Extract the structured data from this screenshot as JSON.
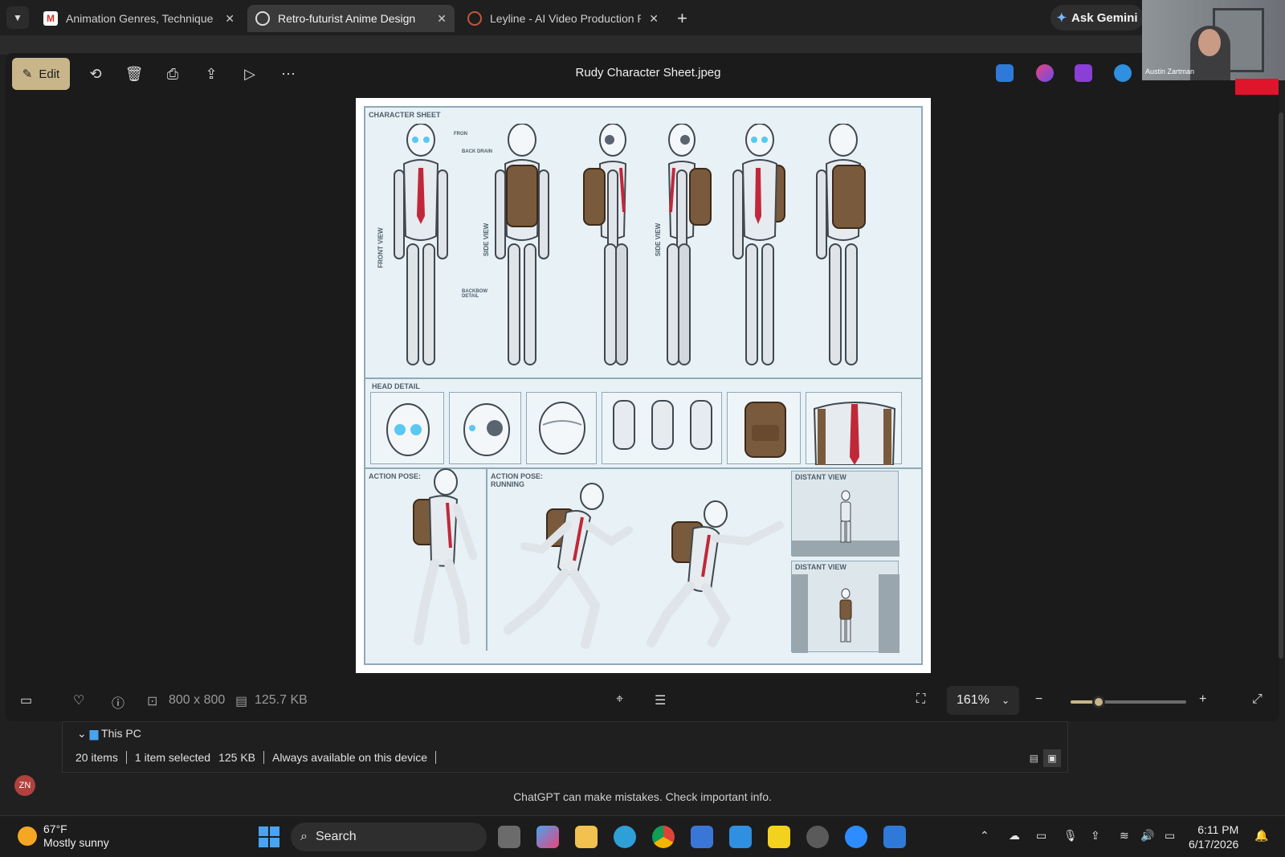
{
  "browser": {
    "tabs": [
      {
        "title": "Animation Genres, Technique a",
        "favicon": "gmail-icon"
      },
      {
        "title": "Retro-futurist Anime Design",
        "favicon": "chatgpt-icon"
      },
      {
        "title": "Leyline - AI Video Production P",
        "favicon": "leyline-icon"
      }
    ],
    "ask_gemini": "Ask Gemini"
  },
  "viewer": {
    "edit_label": "Edit",
    "file_title": "Rudy Character Sheet.jpeg",
    "dimensions": "800 x 800",
    "file_size": "125.7 KB",
    "zoom": "161%",
    "zoom_fraction": 0.24
  },
  "sheet": {
    "title": "CHARACTER SHEET",
    "front_view": "FRONT VIEW",
    "side_view_1": "SIDE VIEW",
    "side_view_2": "SIDE VIEW",
    "fron": "FRON",
    "back_drain": "BACK DRAIN",
    "backbow_detail": "BACKBOW DETAIL",
    "head_detail": "HEAD DETAIL",
    "action_pose": "ACTION POSE:",
    "action_pose_running": "ACTION POSE: RUNNING",
    "distant_view_1": "DISTANT VIEW",
    "distant_view_2": "DISTANT VIEW"
  },
  "explorer": {
    "tree_item": "This PC",
    "items_count": "20 items",
    "selected": "1 item selected",
    "selected_size": "125 KB",
    "availability": "Always available on this device"
  },
  "chatgpt_notice": "ChatGPT can make mistakes. Check important info.",
  "user_initials": "ZN",
  "video": {
    "participant": "Austin Zartman"
  },
  "taskbar": {
    "temperature": "67°F",
    "weather": "Mostly sunny",
    "search_placeholder": "Search",
    "time": "6:11 PM",
    "date": "6/17/2026"
  },
  "colors": {
    "accent": "#c8b58a",
    "bg": "#1b1b1b",
    "record": "#e0142b"
  }
}
